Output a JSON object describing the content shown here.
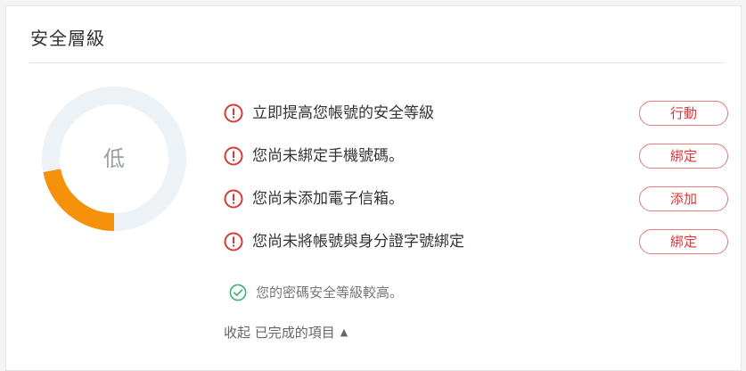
{
  "panel": {
    "title": "安全層級"
  },
  "gauge": {
    "level_label": "低",
    "progress_fraction": 0.22,
    "track_color": "#edf2f6",
    "fill_color": "#f5910b"
  },
  "tasks": [
    {
      "icon": "alert-circle-icon",
      "text": "立即提高您帳號的安全等級",
      "button": "行動"
    },
    {
      "icon": "alert-circle-icon",
      "text": "您尚未綁定手機號碼。",
      "button": "綁定"
    },
    {
      "icon": "alert-circle-icon",
      "text": "您尚未添加電子信箱。",
      "button": "添加"
    },
    {
      "icon": "alert-circle-icon",
      "text": "您尚未將帳號與身分證字號綁定",
      "button": "綁定"
    }
  ],
  "completed": {
    "icon": "check-circle-icon",
    "text": "您的密碼安全等級較高。"
  },
  "collapse": {
    "label": "收起 已完成的項目",
    "icon": "caret-up-icon"
  },
  "colors": {
    "alert": "#d73a3a",
    "success": "#3cb16f",
    "button_border": "#e57b7b"
  }
}
